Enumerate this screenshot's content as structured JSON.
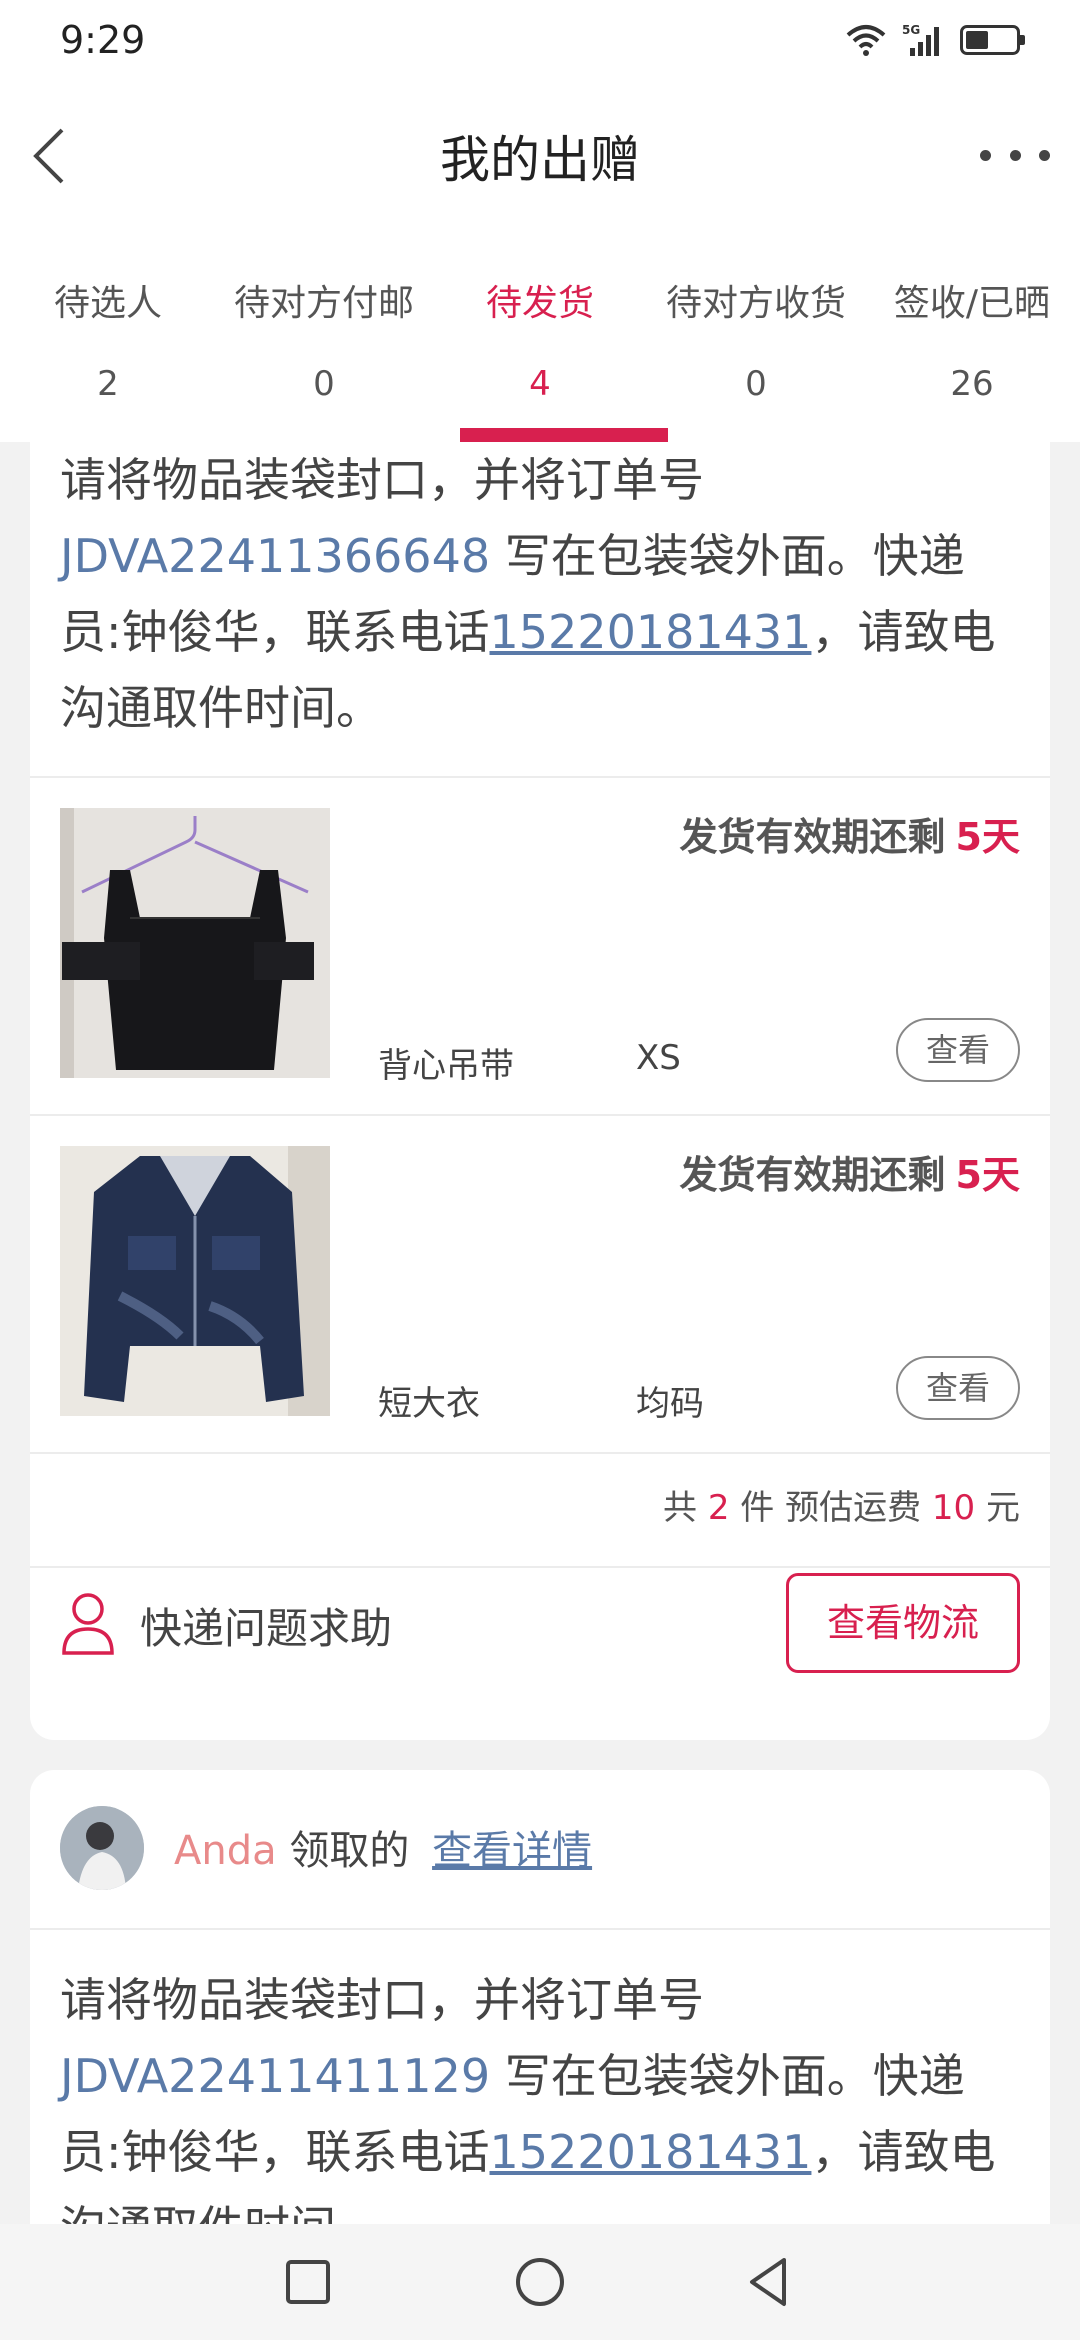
{
  "status_bar": {
    "time": "9:29",
    "signal_label": "5G"
  },
  "header": {
    "title": "我的出赠"
  },
  "tabs": [
    {
      "label": "待选人",
      "count": "2"
    },
    {
      "label": "待对方付邮",
      "count": "0"
    },
    {
      "label": "待发货",
      "count": "4"
    },
    {
      "label": "待对方收货",
      "count": "0"
    },
    {
      "label": "签收/已晒",
      "count": "26"
    }
  ],
  "active_tab_index": 2,
  "colors": {
    "accent": "#d8204f",
    "link": "#5a7aa8",
    "receiver_name": "#e88a8a"
  },
  "order1": {
    "instruction_prefix": "请将物品装袋封口，并将订单号 ",
    "order_no": "JDVA22411366648",
    "instruction_mid": " 写在包装袋外面。快递员:钟俊华，联系电话",
    "phone": "15220181431",
    "instruction_suffix": "，请致电沟通取件时间。",
    "items": [
      {
        "deadline_label": "发货有效期还剩",
        "days": "5天",
        "name": "背心吊带",
        "size": "XS",
        "view_label": "查看",
        "image_icon": "black-camisole-photo"
      },
      {
        "deadline_label": "发货有效期还剩",
        "days": "5天",
        "name": "短大衣",
        "size": "均码",
        "view_label": "查看",
        "image_icon": "denim-jacket-photo"
      }
    ],
    "summary": {
      "prefix": "共 ",
      "count": "2",
      "mid": " 件 预估运费 ",
      "fee": "10",
      "suffix": " 元"
    },
    "help_label": "快递问题求助",
    "logistics_label": "查看物流"
  },
  "order2": {
    "receiver_name": "Anda",
    "receiver_suffix": " 领取的 ",
    "detail_link": "查看详情",
    "instruction_prefix": "请将物品装袋封口，并将订单号 ",
    "order_no": "JDVA22411411129",
    "instruction_mid": " 写在包装袋外面。快递员:钟俊华，联系电话",
    "phone": "15220181431",
    "instruction_suffix": "，请致电沟通取件时间。"
  }
}
